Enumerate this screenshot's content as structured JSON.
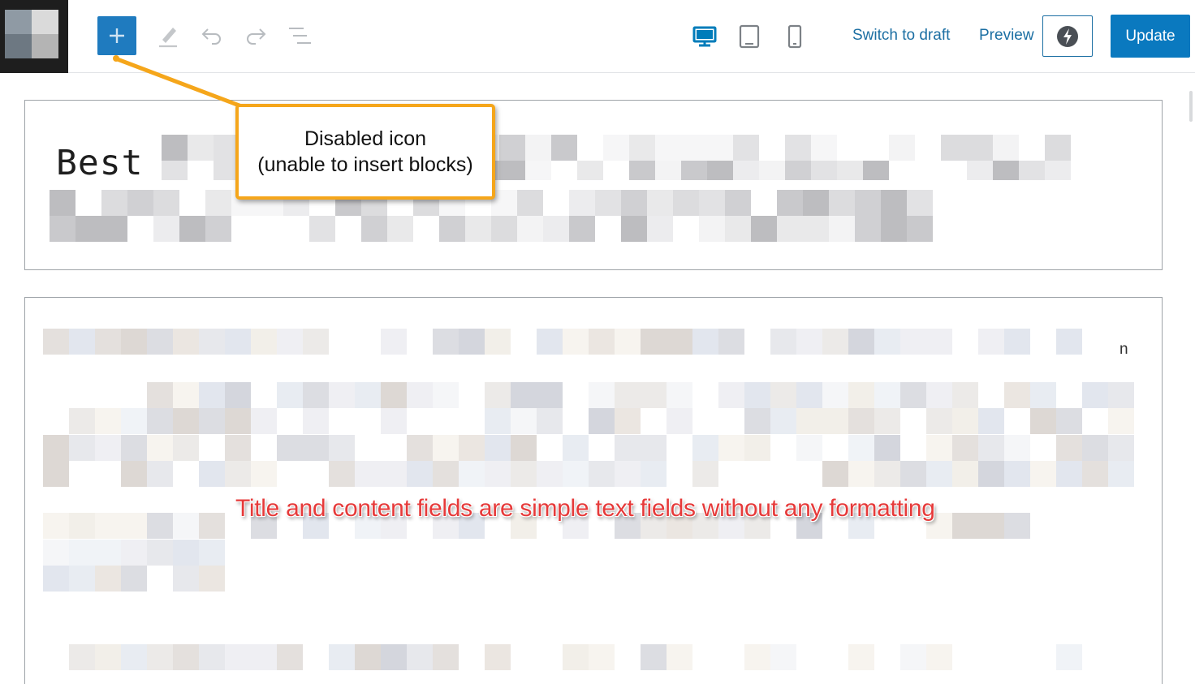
{
  "toolbar": {
    "inserter_icon": "plus-icon",
    "tool_icons": [
      "pencil-icon",
      "undo-icon",
      "redo-icon",
      "list-view-icon"
    ],
    "device_icons": [
      "desktop-icon",
      "tablet-icon",
      "mobile-icon"
    ],
    "active_device": "desktop",
    "switch_to_draft_label": "Switch to draft",
    "preview_label": "Preview",
    "performance_icon": "lightning-icon",
    "update_label": "Update"
  },
  "editor": {
    "title_visible": "Best",
    "content_trailing_char": "n"
  },
  "annotations": {
    "callout_line1": "Disabled icon",
    "callout_line2": "(unable to insert blocks)",
    "red_note": "Title and content fields are simple text fields without any formatting"
  },
  "colors": {
    "accent": "#007cba",
    "update_button": "#0a79bf",
    "callout_border": "#f5a61b",
    "note_text": "#e63a3a"
  }
}
